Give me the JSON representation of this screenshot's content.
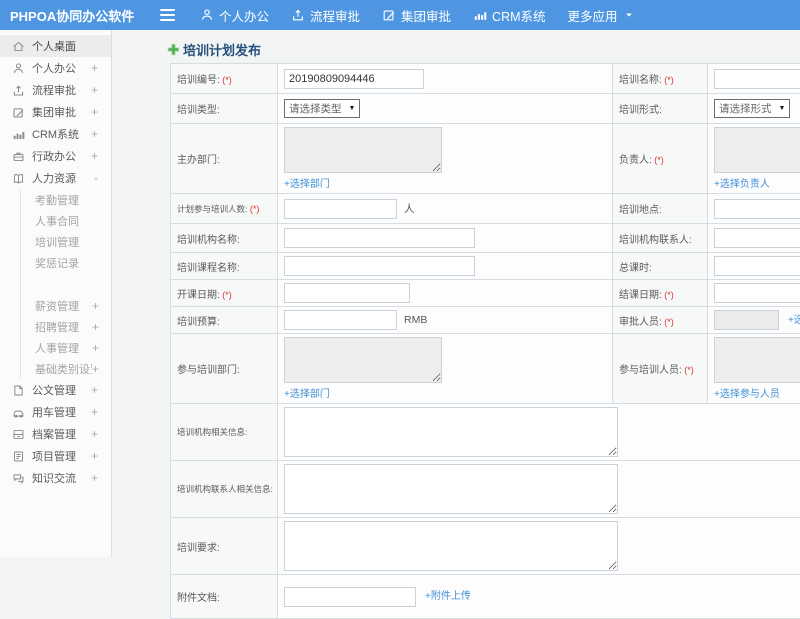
{
  "colors": {
    "topbar_blue": "#4e96e2",
    "link_blue": "#4191d6",
    "required_red": "#e03131",
    "title_navy": "#26507c",
    "plus_green": "#52b153"
  },
  "topbar": {
    "logo": "PHPOA协同办公软件",
    "menu": [
      {
        "label": "个人办公",
        "icon": "user-icon"
      },
      {
        "label": "流程审批",
        "icon": "upload-icon"
      },
      {
        "label": "集团审批",
        "icon": "edit-icon"
      },
      {
        "label": "CRM系统",
        "icon": "chart-icon"
      },
      {
        "label": "更多应用",
        "caret": true
      }
    ]
  },
  "sidebar": {
    "items": [
      {
        "label": "个人桌面",
        "icon": "home-icon",
        "active": true
      },
      {
        "label": "个人办公",
        "icon": "user-icon",
        "expand": "+"
      },
      {
        "label": "流程审批",
        "icon": "upload-icon",
        "expand": "+"
      },
      {
        "label": "集团审批",
        "icon": "edit-icon",
        "expand": "+"
      },
      {
        "label": "CRM系统",
        "icon": "chart-icon",
        "expand": "+"
      },
      {
        "label": "行政办公",
        "icon": "briefcase-icon",
        "expand": "+"
      },
      {
        "label": "人力资源",
        "icon": "book-icon",
        "expand": "-"
      },
      {
        "label": "考勤管理",
        "sub": true
      },
      {
        "label": "人事合同",
        "sub": true
      },
      {
        "label": "培训管理",
        "sub": true
      },
      {
        "label": "奖惩记录",
        "sub": true
      },
      {
        "label": "薪资管理",
        "sub": true,
        "expand": "+",
        "gap": true
      },
      {
        "label": "招聘管理",
        "sub": true,
        "expand": "+"
      },
      {
        "label": "人事管理",
        "sub": true,
        "expand": "+"
      },
      {
        "label": "基础类别设置",
        "sub": true,
        "expand": "+"
      },
      {
        "label": "公文管理",
        "icon": "doc-icon",
        "expand": "+"
      },
      {
        "label": "用车管理",
        "icon": "car-icon",
        "expand": "+"
      },
      {
        "label": "档案管理",
        "icon": "archive-icon",
        "expand": "+"
      },
      {
        "label": "项目管理",
        "icon": "project-icon",
        "expand": "+"
      },
      {
        "label": "知识交流",
        "icon": "chat-icon",
        "expand": "+"
      }
    ]
  },
  "main": {
    "title": "培训计划发布",
    "form": {
      "rows": [
        {
          "cells": [
            {
              "label": "培训编号:",
              "required": true,
              "field": {
                "id": "training_no",
                "type": "input",
                "value": "20190809094446"
              }
            },
            {
              "label": "培训名称:",
              "required": true,
              "field": {
                "id": "training_name",
                "type": "input",
                "value": ""
              }
            }
          ]
        },
        {
          "cells": [
            {
              "label": "培训类型:",
              "field": {
                "id": "training_type",
                "type": "select",
                "value": "请选择类型"
              }
            },
            {
              "label": "培训形式:",
              "field": {
                "id": "training_form",
                "type": "select",
                "value": "请选择形式"
              }
            }
          ]
        },
        {
          "cells": [
            {
              "label": "主办部门:",
              "field": {
                "id": "host_dept",
                "type": "textarea",
                "link": "+选择部门"
              }
            },
            {
              "label": "负责人:",
              "required": true,
              "field": {
                "id": "leader",
                "type": "textarea",
                "link": "+选择负责人"
              }
            }
          ]
        },
        {
          "cells": [
            {
              "label": "计划参与培训人数:",
              "required": true,
              "field": {
                "id": "planned_count",
                "type": "input",
                "value": "",
                "suffix": "人"
              }
            },
            {
              "label": "培训地点:",
              "field": {
                "id": "location",
                "type": "input",
                "value": ""
              }
            }
          ]
        },
        {
          "cells": [
            {
              "label": "培训机构名称:",
              "field": {
                "id": "org_name",
                "type": "input",
                "value": ""
              }
            },
            {
              "label": "培训机构联系人:",
              "field": {
                "id": "org_contact",
                "type": "input",
                "value": ""
              }
            }
          ]
        },
        {
          "cells": [
            {
              "label": "培训课程名称:",
              "field": {
                "id": "course_name",
                "type": "input",
                "value": ""
              }
            },
            {
              "label": "总课时:",
              "field": {
                "id": "total_hours",
                "type": "input",
                "value": ""
              }
            }
          ]
        },
        {
          "cells": [
            {
              "label": "开课日期:",
              "required": true,
              "field": {
                "id": "start_date",
                "type": "input",
                "value": ""
              }
            },
            {
              "label": "结课日期:",
              "required": true,
              "field": {
                "id": "end_date",
                "type": "input",
                "value": ""
              }
            }
          ]
        },
        {
          "cells": [
            {
              "label": "培训预算:",
              "field": {
                "id": "budget",
                "type": "input",
                "value": "",
                "suffix": "RMB"
              }
            },
            {
              "label": "审批人员:",
              "required": true,
              "field": {
                "id": "approver",
                "type": "input-gray",
                "link": "+选择审批人员"
              }
            }
          ]
        },
        {
          "cells": [
            {
              "label": "参与培训部门:",
              "field": {
                "id": "join_depts",
                "type": "textarea",
                "link": "+选择部门"
              }
            },
            {
              "label": "参与培训人员:",
              "required": true,
              "field": {
                "id": "join_members",
                "type": "textarea",
                "link": "+选择参与人员"
              }
            }
          ]
        },
        {
          "span": true,
          "cells": [
            {
              "label": "培训机构相关信息:",
              "field": {
                "id": "org_info",
                "type": "textarea-big"
              }
            }
          ]
        },
        {
          "span": true,
          "cells": [
            {
              "label": "培训机构联系人相关信息:",
              "field": {
                "id": "org_contact_info",
                "type": "textarea-big"
              }
            }
          ]
        },
        {
          "span": true,
          "cells": [
            {
              "label": "培训要求:",
              "field": {
                "id": "requirements",
                "type": "textarea-big"
              }
            }
          ]
        },
        {
          "span": true,
          "cells": [
            {
              "label": "附件文档:",
              "field": {
                "id": "attachment",
                "type": "input",
                "value": "",
                "link": "+附件上传"
              }
            }
          ]
        }
      ]
    }
  }
}
